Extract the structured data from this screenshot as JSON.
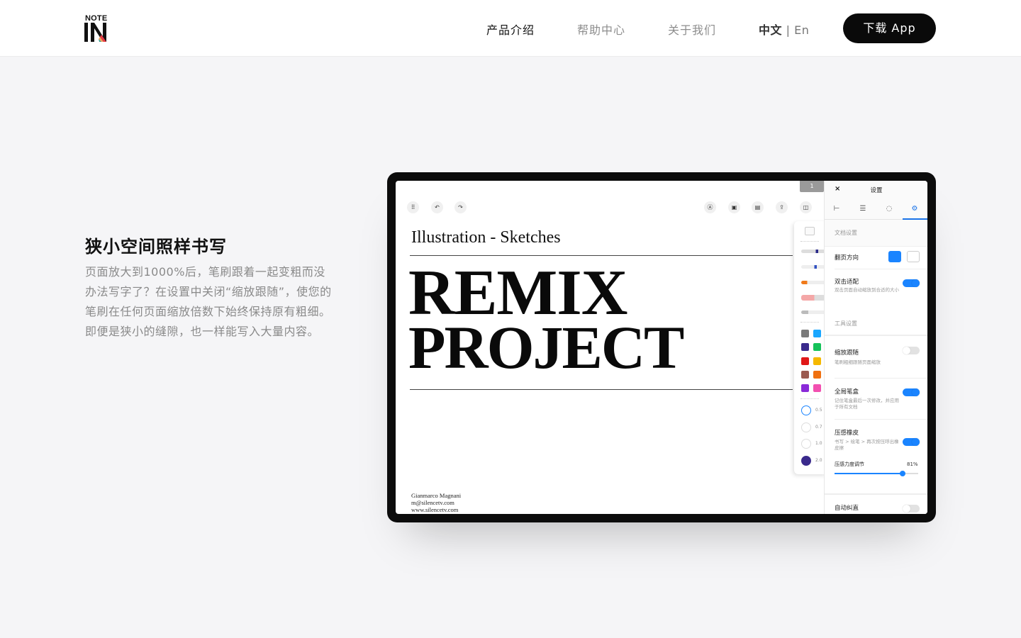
{
  "brand": {
    "note": "NOTE",
    "colors": {
      "i": "#111111",
      "n": "#111111",
      "accent": "#e63946"
    }
  },
  "nav": {
    "product": "产品介绍",
    "help": "帮助中心",
    "about": "关于我们",
    "lang_zh": "中文",
    "lang_sep": " | ",
    "lang_en": "En",
    "download": "下载 App"
  },
  "feature": {
    "title": "狭小空间照样书写",
    "desc": "页面放大到1000%后，笔刷跟着一起变粗而没办法写字了？在设置中关闭“缩放跟随”，使您的笔刷在任何页面缩放倍数下始终保持原有粗细。即便是狭小的缝隙，也一样能写入大量内容。"
  },
  "app": {
    "toolbar_left": [
      "apps-icon",
      "undo-icon",
      "redo-icon"
    ],
    "toolbar_right": [
      "pen-mode-icon",
      "image-icon",
      "page-icon",
      "share-icon",
      "panel-icon"
    ],
    "page_number": "1",
    "doc": {
      "title": "Illustration - Sketches",
      "headline_1": "REMIX",
      "headline_2": "PROJECT",
      "credit_1": "Gianmarco Magnani",
      "credit_2": "m@silencetv.com",
      "credit_3": "www.silencetv.com"
    },
    "pens": [
      {
        "color": "#2a2a8a"
      },
      {
        "color": "#3050c0"
      },
      {
        "color": "#f07a1a"
      },
      {
        "color": "#f4a7a7"
      },
      {
        "color": "#b0b0b0"
      }
    ],
    "swatches": [
      "#7a7a7a",
      "#1aa7ff",
      "#3a2a8c",
      "#16c25a",
      "#e01818",
      "#f5b800",
      "#9a5a50",
      "#f07010",
      "#8a2ad8",
      "#f250b0"
    ],
    "brush_sizes": [
      "0.5",
      "0.7",
      "1.0",
      "2.0"
    ],
    "settings": {
      "title": "设置",
      "close": "×",
      "doc_section": "文档设置",
      "flip_direction": "翻页方向",
      "double_tap": "双击适配",
      "double_tap_sub": "双击页面自动缩放到合适的大小",
      "double_tap_on": true,
      "tool_section": "工具设置",
      "zoom_follow": "缩放跟随",
      "zoom_follow_sub": "笔刷粗细跟随页面缩放",
      "zoom_follow_on": false,
      "global_pen": "全局笔盒",
      "global_pen_sub": "记住笔盒最后一次修改，并应用于所有文档",
      "global_pen_on": true,
      "pressure_eraser": "压感橡皮",
      "pressure_eraser_sub": "书写 > 绘笔 > 再次按压呼出橡皮擦",
      "pressure_eraser_on": true,
      "pressure_level": "压感力度调节",
      "pressure_value": 81,
      "pressure_value_label": "81%",
      "auto_straighten": "自动纠直",
      "auto_straighten_on": false
    }
  }
}
